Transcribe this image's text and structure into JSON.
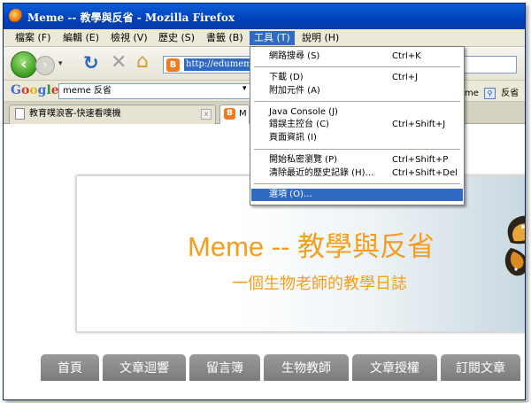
{
  "window": {
    "title": "Meme -- 教學與反省 - Mozilla Firefox"
  },
  "menubar": {
    "items": [
      {
        "label": "檔案 (F)"
      },
      {
        "label": "編輯 (E)"
      },
      {
        "label": "檢視 (V)"
      },
      {
        "label": "歷史 (S)"
      },
      {
        "label": "書籤 (B)"
      },
      {
        "label": "工具 (T)"
      },
      {
        "label": "說明 (H)"
      }
    ],
    "active": "工具 (T)"
  },
  "navbar": {
    "back": "‹",
    "forward": "›",
    "dropdown": "▾",
    "reload": "↻",
    "stop": "✕",
    "home": "⌂",
    "url_favicon": "B",
    "url": "http://edumeme"
  },
  "google_toolbar": {
    "logo": [
      "G",
      "o",
      "o",
      "g",
      "l",
      "e"
    ],
    "search_value": "meme 反省",
    "search_drop": "▾",
    "right_text_1": "me",
    "right_text_2": "反省",
    "search_icon": "magnifier-icon"
  },
  "tabs": [
    {
      "label": "教育噗浪客-快速看噗機",
      "close": "x"
    },
    {
      "label": "M",
      "icon": "B"
    }
  ],
  "page": {
    "title": "Meme -- 教學與反省",
    "subtitle": "一個生物老師的教學日誌",
    "nav": [
      "首頁",
      "文章迴響",
      "留言簿",
      "生物教師",
      "文章授權",
      "訂閱文章"
    ]
  },
  "tools_menu": {
    "items": [
      {
        "label": "網路搜尋 (S)",
        "shortcut": "Ctrl+K"
      },
      {
        "label": "下載 (D)",
        "shortcut": "Ctrl+J"
      },
      {
        "label": "附加元件 (A)",
        "shortcut": ""
      },
      {
        "label": "Java Console (J)",
        "shortcut": ""
      },
      {
        "label": "錯誤主控台 (C)",
        "shortcut": "Ctrl+Shift+J"
      },
      {
        "label": "頁面資訊 (I)",
        "shortcut": ""
      },
      {
        "label": "開始私密瀏覽 (P)",
        "shortcut": "Ctrl+Shift+P"
      },
      {
        "label": "清除最近的歷史記錄 (H)…",
        "shortcut": "Ctrl+Shift+Del"
      },
      {
        "label": "選項 (O)…",
        "shortcut": ""
      }
    ],
    "highlighted": "選項 (O)…"
  },
  "colors": {
    "accent_orange": "#f59d1c",
    "highlight_blue": "#316ac5",
    "titlebar_blue": "#0a5fd8",
    "nav_tab_gray": "#8a8a8a"
  }
}
